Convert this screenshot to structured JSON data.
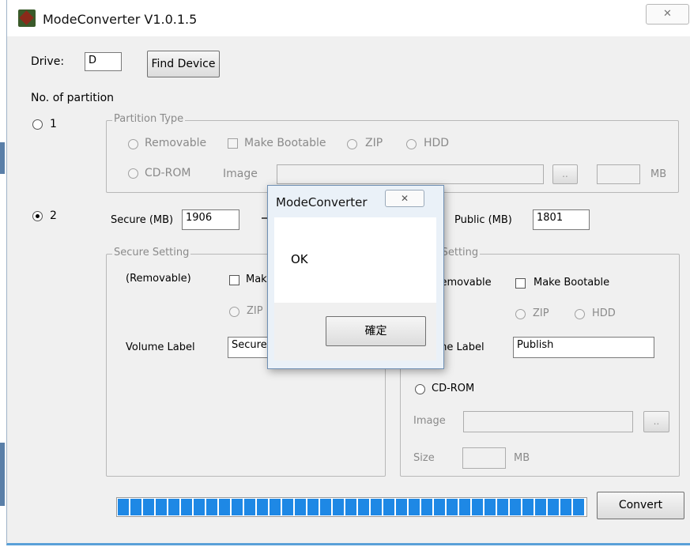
{
  "window": {
    "title": "ModeConverter V1.0.1.5",
    "close_glyph": "✕"
  },
  "drive": {
    "label": "Drive:",
    "value": "D",
    "find_button": "Find Device"
  },
  "partition": {
    "heading": "No. of partition",
    "option_1": "1",
    "option_2": "2",
    "selected": "2"
  },
  "partition_type": {
    "legend": "Partition Type",
    "removable": "Removable",
    "make_bootable": "Make Bootable",
    "zip": "ZIP",
    "hdd": "HDD",
    "cdrom": "CD-ROM",
    "image_label": "Image",
    "browse": "..",
    "unit": "MB"
  },
  "sizes": {
    "secure_label": "Secure (MB)",
    "secure_value": "1906",
    "public_label": "Public (MB)",
    "public_value": "1801"
  },
  "secure_setting": {
    "legend": "Secure Setting",
    "removable": "(Removable)",
    "make_bootable": "Make Bootable",
    "zip": "ZIP",
    "volume_label": "Volume Label",
    "volume_value": "Secure"
  },
  "public_setting": {
    "legend": "Public Setting",
    "removable": "Removable",
    "make_bootable": "Make Bootable",
    "zip": "ZIP",
    "hdd": "HDD",
    "volume_label": "Volume Label",
    "volume_value": "Publish",
    "cdrom": "CD-ROM",
    "image_label": "Image",
    "browse": "..",
    "size_label": "Size",
    "unit": "MB"
  },
  "progress": {
    "fraction": 1.0
  },
  "convert_button": "Convert",
  "dialog": {
    "title": "ModeConverter",
    "close_glyph": "✕",
    "message": "OK",
    "ok_button": "確定"
  }
}
